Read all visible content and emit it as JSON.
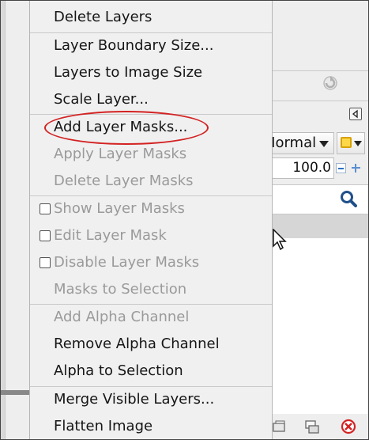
{
  "menu": {
    "items": [
      {
        "label": "Delete Layers",
        "enabled": true,
        "checkbox": false
      },
      {
        "label": "Layer Boundary Size...",
        "enabled": true,
        "checkbox": false
      },
      {
        "label": "Layers to Image Size",
        "enabled": true,
        "checkbox": false
      },
      {
        "label": "Scale Layer...",
        "enabled": true,
        "checkbox": false
      },
      {
        "label": "Add Layer Masks...",
        "enabled": true,
        "checkbox": false,
        "highlighted": true
      },
      {
        "label": "Apply Layer Masks",
        "enabled": false,
        "checkbox": false
      },
      {
        "label": "Delete Layer Masks",
        "enabled": false,
        "checkbox": false
      },
      {
        "label": "Show Layer Masks",
        "enabled": false,
        "checkbox": true,
        "checked": false
      },
      {
        "label": "Edit Layer Mask",
        "enabled": false,
        "checkbox": true,
        "checked": false
      },
      {
        "label": "Disable Layer Masks",
        "enabled": false,
        "checkbox": true,
        "checked": false
      },
      {
        "label": "Masks to Selection",
        "enabled": false,
        "checkbox": false
      },
      {
        "label": "Add Alpha Channel",
        "enabled": false,
        "checkbox": false
      },
      {
        "label": "Remove Alpha Channel",
        "enabled": true,
        "checkbox": false
      },
      {
        "label": "Alpha to Selection",
        "enabled": true,
        "checkbox": false
      },
      {
        "label": "Merge Visible Layers...",
        "enabled": true,
        "checkbox": false
      },
      {
        "label": "Flatten Image",
        "enabled": true,
        "checkbox": false
      }
    ]
  },
  "layers_panel": {
    "mode_value": "Normal",
    "opacity_value": "100.0",
    "icons": [
      "refresh-icon",
      "collapse-panel-icon",
      "composite-mode-icon",
      "minus-icon",
      "plus-icon",
      "search-icon",
      "new-layer-group-icon",
      "anchor-icon",
      "delete-icon"
    ]
  },
  "colors": {
    "menu_bg": "#f0f0f0",
    "text_enabled": "#151515",
    "text_disabled": "#9a9a9a",
    "highlight_ellipse": "#d32222",
    "delete_icon": "#d32222"
  }
}
